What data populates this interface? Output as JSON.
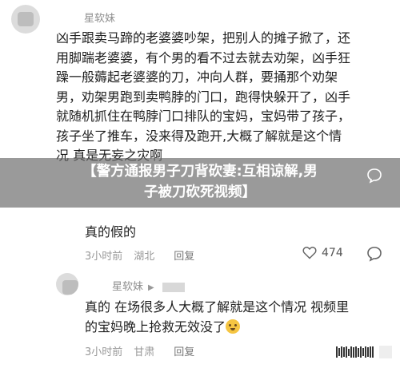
{
  "comment1": {
    "username": "星软妹",
    "lines": [
      "凶手跟卖马蹄的老婆婆吵架，把别人的摊子掀了，还",
      "用脚踹老婆婆，有个男的看不过去就去劝架，凶手狂",
      "躁一般薅起老婆婆的刀，冲向人群，要捅那个劝架",
      "男，劝架男跑到卖鸭脖的门口，跑得快躲开了，凶手",
      "就随机抓住在鸭脖门口排队的宝妈，宝妈带了孩子，",
      "孩子坐了推车，没来得及跑开,大概了解就是这个情",
      "况 真是无妄之灾啊"
    ]
  },
  "overlay": {
    "line1": "【警方通报男子刀背砍妻:互相谅解,男",
    "line2": "子被刀砍死视频】"
  },
  "comment2": {
    "text": "真的假的",
    "time": "3小时前",
    "location": "湖北",
    "reply_label": "回复",
    "likes": "474"
  },
  "comment3": {
    "username": "星软妹",
    "reply_to": "▶",
    "line1": "真的 在场很多人大概了解就是这个情况 视频里",
    "line2": "的宝妈晚上抢救无效没了",
    "time": "3小时前",
    "location": "甘肃",
    "reply_label": "回复"
  },
  "icons": {
    "like": "heart-icon",
    "comment": "comment-bubble-icon",
    "emoji": "crying-face-emoji"
  }
}
